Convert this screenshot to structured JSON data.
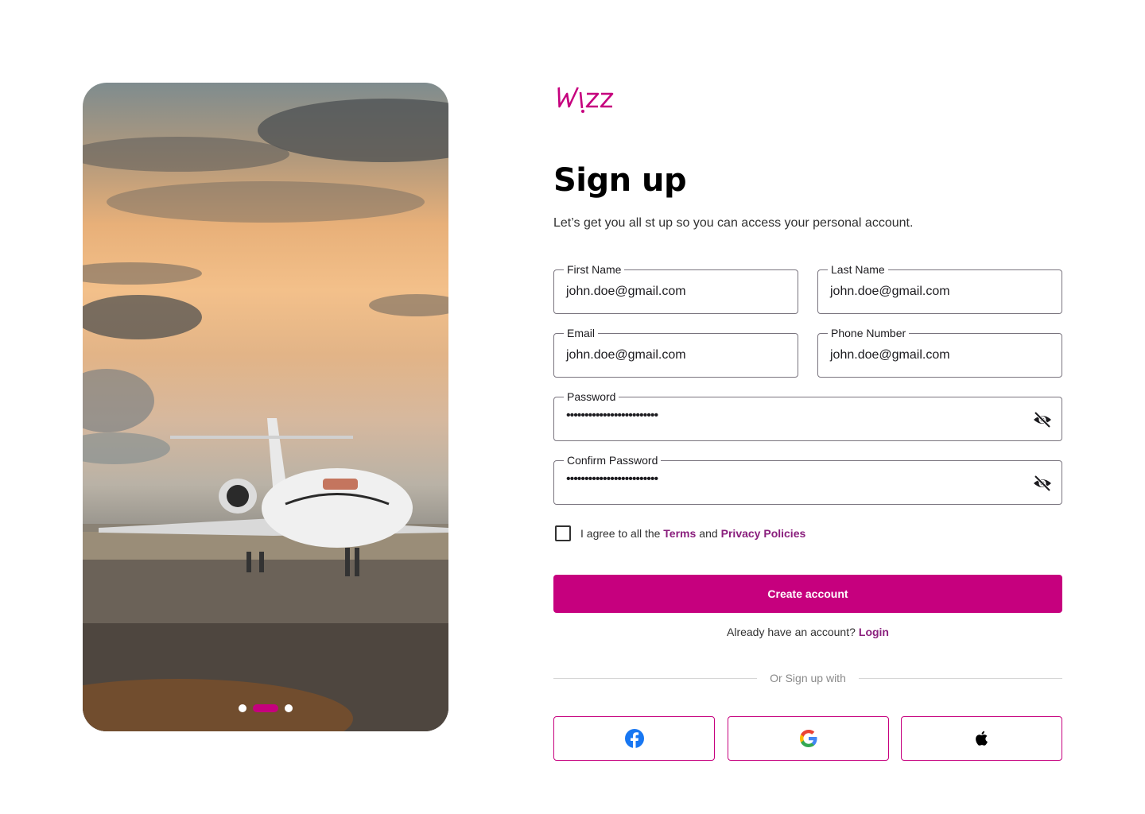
{
  "brand": {
    "logo_text": "Wizz",
    "accent_color": "#c6007e"
  },
  "hero": {
    "image_alt": "Private jet on runway at sunset",
    "carousel": {
      "count": 3,
      "active_index": 1
    }
  },
  "form": {
    "title": "Sign up",
    "subtitle": "Let’s get you all st up so you can access your personal account.",
    "fields": {
      "first_name": {
        "label": "First Name",
        "value": "john.doe@gmail.com"
      },
      "last_name": {
        "label": "Last Name",
        "value": "john.doe@gmail.com"
      },
      "email": {
        "label": "Email",
        "value": "john.doe@gmail.com"
      },
      "phone": {
        "label": "Phone Number",
        "value": "john.doe@gmail.com"
      },
      "password": {
        "label": "Password",
        "value": "•••••••••••••••••••••••••",
        "icon": "eye-off-icon"
      },
      "confirm_password": {
        "label": "Confirm Password",
        "value": "•••••••••••••••••••••••••",
        "icon": "eye-off-icon"
      }
    },
    "agree": {
      "prefix": "I agree to all the",
      "terms": "Terms",
      "and": "and",
      "privacy": "Privacy Policies",
      "checked": false
    },
    "create_button": "Create account",
    "already": {
      "text": "Already have an account?",
      "login": "Login"
    },
    "divider": "Or Sign up with",
    "social": [
      {
        "name": "facebook",
        "icon": "facebook-icon"
      },
      {
        "name": "google",
        "icon": "google-icon"
      },
      {
        "name": "apple",
        "icon": "apple-icon"
      }
    ]
  }
}
